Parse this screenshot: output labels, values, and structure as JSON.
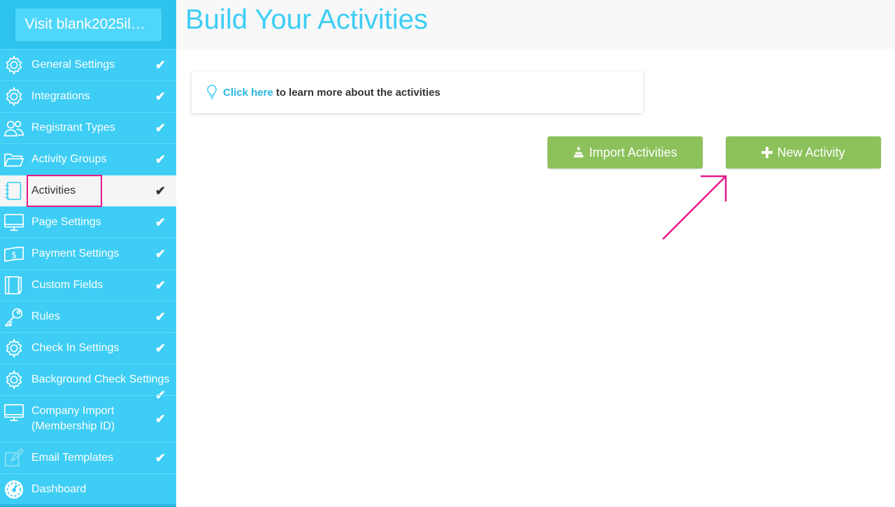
{
  "sidebar": {
    "visit_label": "Visit blank2025il…",
    "items": [
      {
        "label": "General Settings",
        "icon": "gear-icon",
        "check": "✔"
      },
      {
        "label": "Integrations",
        "icon": "gear-icon",
        "check": "✔"
      },
      {
        "label": "Registrant Types",
        "icon": "users-icon",
        "check": "✔"
      },
      {
        "label": "Activity Groups",
        "icon": "folder-icon",
        "check": "✔"
      },
      {
        "label": "Activities",
        "icon": "notebook-icon",
        "check": "✔"
      },
      {
        "label": "Page Settings",
        "icon": "monitor-icon",
        "check": "✔"
      },
      {
        "label": "Payment Settings",
        "icon": "dollar-bill-icon",
        "check": "✔"
      },
      {
        "label": "Custom Fields",
        "icon": "book-pen-icon",
        "check": "✔"
      },
      {
        "label": "Rules",
        "icon": "key-icon",
        "check": "✔"
      },
      {
        "label": "Check In Settings",
        "icon": "gear-icon",
        "check": "✔"
      },
      {
        "label": "Background Check Settings",
        "icon": "gear-icon",
        "check": "✔"
      },
      {
        "label_line1": "Company Import",
        "label_line2": "(Membership ID)",
        "icon": "monitor-icon",
        "check": "✔"
      },
      {
        "label": "Email Templates",
        "icon": "edit-icon",
        "check": "✔"
      },
      {
        "label": "Dashboard",
        "icon": "gauge-icon",
        "check": ""
      }
    ]
  },
  "header": {
    "title": "Build Your Activities"
  },
  "info": {
    "link_text": "Click here",
    "text": "to learn more about the activities"
  },
  "actions": {
    "import_label": "Import Activities",
    "new_label": "New Activity"
  },
  "colors": {
    "sidebar": "#3dcdf5",
    "accent": "#3dcdf5",
    "button_green": "#8cc15c",
    "highlight": "#e6198a"
  }
}
